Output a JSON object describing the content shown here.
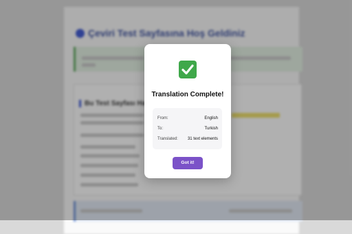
{
  "background_page": {
    "heading": "Çeviri Test Sayfasına Hoş Geldiniz",
    "section_title": "Bu Test Sayfası Hakkında"
  },
  "modal": {
    "icon": "check-mark-icon",
    "title": "Translation Complete!",
    "details": {
      "from_label": "From:",
      "from_value": "English",
      "to_label": "To:",
      "to_value": "Turkish",
      "translated_label": "Translated:",
      "translated_value": "31 text elements"
    },
    "button_label": "Got it!"
  },
  "colors": {
    "accent": "#7b52c8",
    "success": "#3fa84a"
  }
}
